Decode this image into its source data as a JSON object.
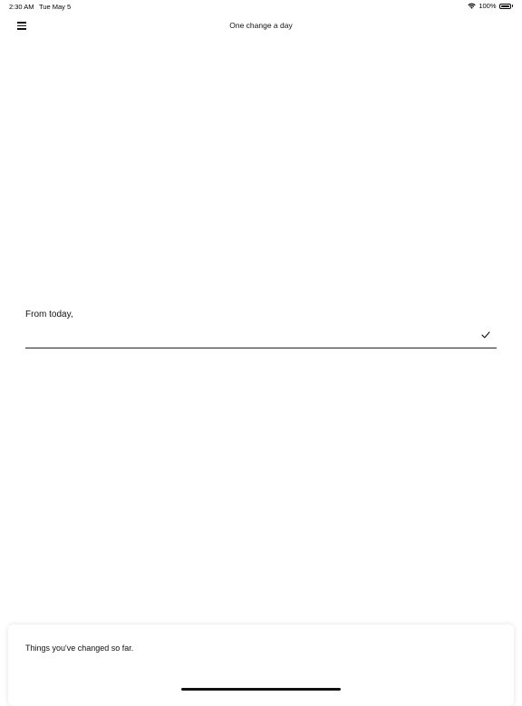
{
  "status_bar": {
    "time": "2:30 AM",
    "date": "Tue May 5",
    "battery": "100%",
    "battery_level": 1.0
  },
  "nav": {
    "title": "One change a day",
    "menu_icon": "hamburger-menu-icon"
  },
  "form": {
    "label": "From today,",
    "input_value": "",
    "submit_icon": "checkmark-icon"
  },
  "history": {
    "title": "Things you've changed so far."
  },
  "colors": {
    "background": "#ffffff",
    "text": "#111111",
    "underline": "#222222"
  }
}
